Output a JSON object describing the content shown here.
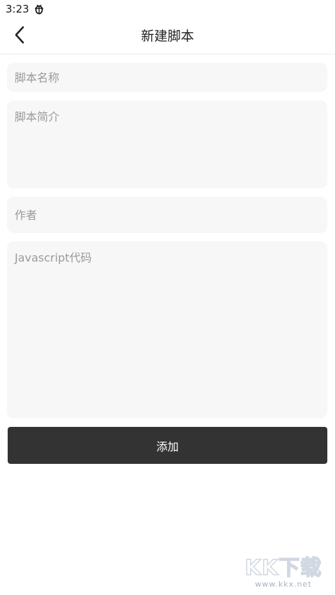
{
  "status_bar": {
    "time": "3:23",
    "app_icon": "bug-icon"
  },
  "header": {
    "title": "新建脚本",
    "back_icon": "chevron-left-icon"
  },
  "form": {
    "name": {
      "value": "",
      "placeholder": "脚本名称"
    },
    "description": {
      "value": "",
      "placeholder": "脚本简介"
    },
    "author": {
      "value": "",
      "placeholder": "作者"
    },
    "code": {
      "value": "",
      "placeholder": "Javascript代码"
    }
  },
  "actions": {
    "add_label": "添加"
  },
  "watermark": {
    "logo": "KK下载",
    "url": "www.kkx.net"
  },
  "colors": {
    "field_background": "#f7f7f7",
    "button_background": "#333333",
    "placeholder": "#9a9a9a"
  }
}
